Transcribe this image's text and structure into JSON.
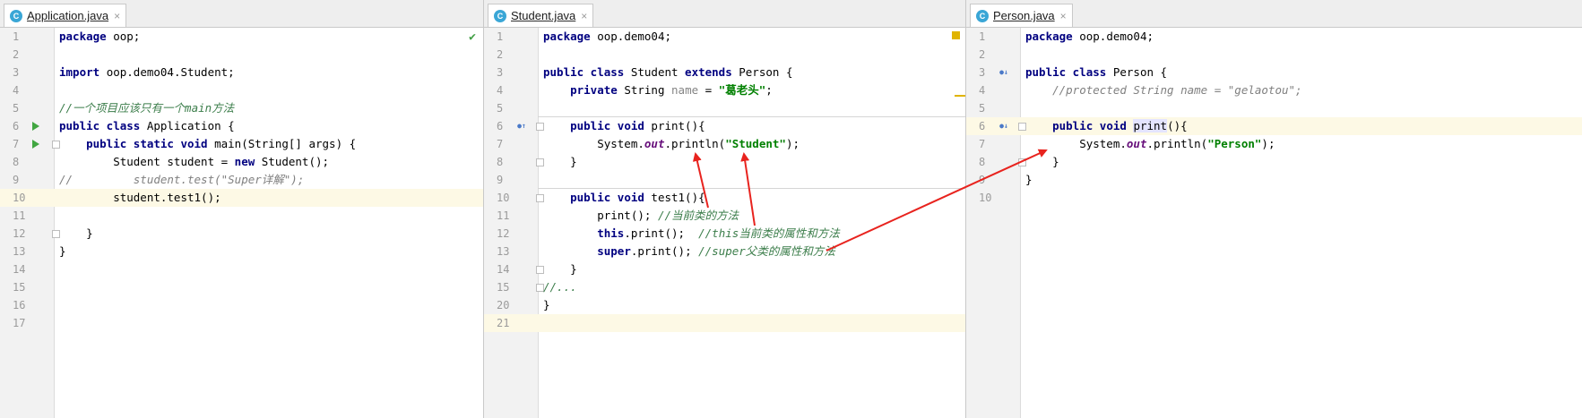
{
  "panes": [
    {
      "tab": {
        "icon": "class-icon",
        "icon_glyph": "C",
        "name": "Application.java",
        "close": "×"
      },
      "lines": [
        {
          "n": "1",
          "segs": [
            [
              "kw",
              "package"
            ],
            [
              "",
              "oop;"
            ]
          ]
        },
        {
          "n": "2",
          "segs": []
        },
        {
          "n": "3",
          "segs": [
            [
              "kw",
              "import"
            ],
            [
              "",
              "oop.demo04.Student;"
            ]
          ]
        },
        {
          "n": "4",
          "segs": []
        },
        {
          "n": "5",
          "segs": [
            [
              "cmt-green",
              "//一个项目应该只有一个main方法"
            ]
          ]
        },
        {
          "n": "6",
          "segs": [
            [
              "kw",
              "public class"
            ],
            [
              "",
              "Application {"
            ]
          ],
          "gutter": "run"
        },
        {
          "n": "7",
          "segs": [
            [
              "",
              "    "
            ],
            [
              "kw",
              "public static void"
            ],
            [
              "",
              " main(String[] args) {"
            ]
          ],
          "gutter": "run",
          "fold": true
        },
        {
          "n": "8",
          "segs": [
            [
              "",
              "        Student student = "
            ],
            [
              "kw",
              "new"
            ],
            [
              "",
              " Student();"
            ]
          ]
        },
        {
          "n": "9",
          "segs": [
            [
              "cmt",
              "//         student.test(\"Super详解\");"
            ]
          ]
        },
        {
          "n": "10",
          "segs": [
            [
              "",
              "        student.test1();"
            ]
          ],
          "caret": true
        },
        {
          "n": "11",
          "segs": []
        },
        {
          "n": "12",
          "segs": [
            [
              "",
              "    }"
            ]
          ],
          "fold": true
        },
        {
          "n": "13",
          "segs": [
            [
              "",
              "}"
            ]
          ]
        },
        {
          "n": "14",
          "segs": []
        },
        {
          "n": "15",
          "segs": []
        },
        {
          "n": "16",
          "segs": []
        },
        {
          "n": "17",
          "segs": []
        }
      ]
    },
    {
      "tab": {
        "icon": "class-icon",
        "icon_glyph": "C",
        "name": "Student.java",
        "close": "×"
      },
      "lines": [
        {
          "n": "1",
          "segs": [
            [
              "kw",
              "package"
            ],
            [
              "",
              " oop.demo04;"
            ]
          ]
        },
        {
          "n": "2",
          "segs": []
        },
        {
          "n": "3",
          "segs": [
            [
              "kw",
              "public class"
            ],
            [
              "",
              " Student "
            ],
            [
              "kw",
              "extends"
            ],
            [
              "",
              " Person {"
            ]
          ]
        },
        {
          "n": "4",
          "segs": [
            [
              "",
              "    "
            ],
            [
              "kw",
              "private"
            ],
            [
              "",
              " String "
            ],
            [
              "mem",
              "name"
            ],
            [
              "",
              " = "
            ],
            [
              "str",
              "\"葛老头\""
            ],
            [
              "",
              ";"
            ]
          ]
        },
        {
          "n": "5",
          "segs": []
        },
        {
          "n": "6",
          "segs": [
            [
              "",
              "    "
            ],
            [
              "kw",
              "public void"
            ],
            [
              "",
              " print(){"
            ]
          ],
          "gutter": "override-up",
          "fold": true
        },
        {
          "n": "7",
          "segs": [
            [
              "",
              "        System."
            ],
            [
              "fld",
              "out"
            ],
            [
              "",
              ".println("
            ],
            [
              "str",
              "\"Student\""
            ],
            [
              "",
              ");"
            ]
          ]
        },
        {
          "n": "8",
          "segs": [
            [
              "",
              "    }"
            ]
          ],
          "fold": true
        },
        {
          "n": "9",
          "segs": []
        },
        {
          "n": "10",
          "segs": [
            [
              "",
              "    "
            ],
            [
              "kw",
              "public void"
            ],
            [
              "",
              " test1(){"
            ]
          ],
          "fold": true
        },
        {
          "n": "11",
          "segs": [
            [
              "",
              "        print(); "
            ],
            [
              "cmt-green",
              "//当前类的方法"
            ]
          ]
        },
        {
          "n": "12",
          "segs": [
            [
              "",
              "        "
            ],
            [
              "kw",
              "this"
            ],
            [
              "",
              ".print();  "
            ],
            [
              "cmt-green",
              "//this当前类的属性和方法"
            ]
          ]
        },
        {
          "n": "13",
          "segs": [
            [
              "",
              "        "
            ],
            [
              "kw",
              "super"
            ],
            [
              "",
              ".print(); "
            ],
            [
              "cmt-green",
              "//super父类的属性和方法"
            ]
          ]
        },
        {
          "n": "14",
          "segs": [
            [
              "",
              "    }"
            ]
          ],
          "fold": true
        },
        {
          "n": "15",
          "segs": [
            [
              "cmt-green",
              "//..."
            ]
          ],
          "fold": true
        },
        {
          "n": "20",
          "segs": [
            [
              "",
              "}"
            ]
          ]
        },
        {
          "n": "21",
          "segs": [],
          "caret": true
        }
      ]
    },
    {
      "tab": {
        "icon": "class-icon",
        "icon_glyph": "C",
        "name": "Person.java",
        "close": "×"
      },
      "lines": [
        {
          "n": "1",
          "segs": [
            [
              "kw",
              "package"
            ],
            [
              "",
              " oop.demo04;"
            ]
          ]
        },
        {
          "n": "2",
          "segs": []
        },
        {
          "n": "3",
          "segs": [
            [
              "kw",
              "public class"
            ],
            [
              "",
              " Person {"
            ]
          ],
          "gutter": "overridden-down"
        },
        {
          "n": "4",
          "segs": [
            [
              "cmt",
              "    //protected String name = \"gelaotou\";"
            ]
          ]
        },
        {
          "n": "5",
          "segs": []
        },
        {
          "n": "6",
          "segs": [
            [
              "",
              "    "
            ],
            [
              "kw",
              "public void"
            ],
            [
              "",
              " "
            ],
            [
              "hl",
              "print"
            ],
            [
              "",
              "(){"
            ]
          ],
          "gutter": "overridden-down",
          "fold": true,
          "caret": true
        },
        {
          "n": "7",
          "segs": [
            [
              "",
              "        System."
            ],
            [
              "fld",
              "out"
            ],
            [
              "",
              ".println("
            ],
            [
              "str",
              "\"Person\""
            ],
            [
              "",
              ");"
            ]
          ]
        },
        {
          "n": "8",
          "segs": [
            [
              "",
              "    }"
            ]
          ],
          "fold": true
        },
        {
          "n": "9",
          "segs": [
            [
              "",
              "}"
            ]
          ]
        },
        {
          "n": "10",
          "segs": []
        }
      ]
    }
  ],
  "colors": {
    "annotation_red": "#e8231e",
    "accent_blue": "#3aa6d6",
    "ok_green": "#43a047"
  }
}
